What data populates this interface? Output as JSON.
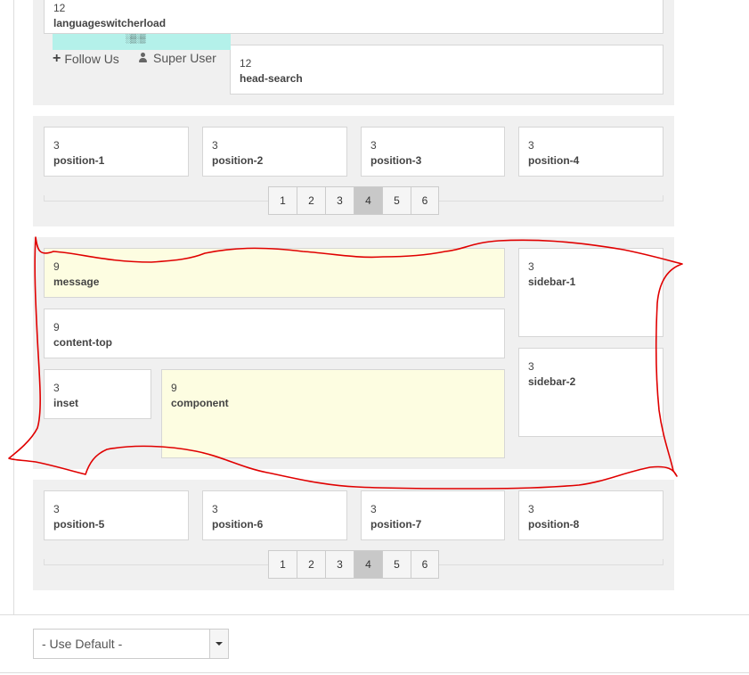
{
  "header_row": {
    "lang": {
      "num": "12",
      "name": "languageswitcherload"
    },
    "search": {
      "num": "12",
      "name": "head-search"
    },
    "follow_label": "Follow Us",
    "user_label": "Super User"
  },
  "top_positions": [
    {
      "num": "3",
      "name": "position-1"
    },
    {
      "num": "3",
      "name": "position-2"
    },
    {
      "num": "3",
      "name": "position-3"
    },
    {
      "num": "3",
      "name": "position-4"
    }
  ],
  "pager_top": {
    "pages": [
      "1",
      "2",
      "3",
      "4",
      "5",
      "6"
    ],
    "active": "4"
  },
  "main": {
    "message": {
      "num": "9",
      "name": "message"
    },
    "content_top": {
      "num": "9",
      "name": "content-top"
    },
    "inset": {
      "num": "3",
      "name": "inset"
    },
    "component": {
      "num": "9",
      "name": "component"
    },
    "sidebar1": {
      "num": "3",
      "name": "sidebar-1"
    },
    "sidebar2": {
      "num": "3",
      "name": "sidebar-2"
    }
  },
  "bottom_positions": [
    {
      "num": "3",
      "name": "position-5"
    },
    {
      "num": "3",
      "name": "position-6"
    },
    {
      "num": "3",
      "name": "position-7"
    },
    {
      "num": "3",
      "name": "position-8"
    }
  ],
  "pager_bottom": {
    "pages": [
      "1",
      "2",
      "3",
      "4",
      "5",
      "6"
    ],
    "active": "4"
  },
  "select": {
    "value": "- Use Default -"
  },
  "annotation_color": "#e00000",
  "highlight_colors": {
    "yellow": "#fdfde1",
    "cyan": "#b4f1ea"
  }
}
